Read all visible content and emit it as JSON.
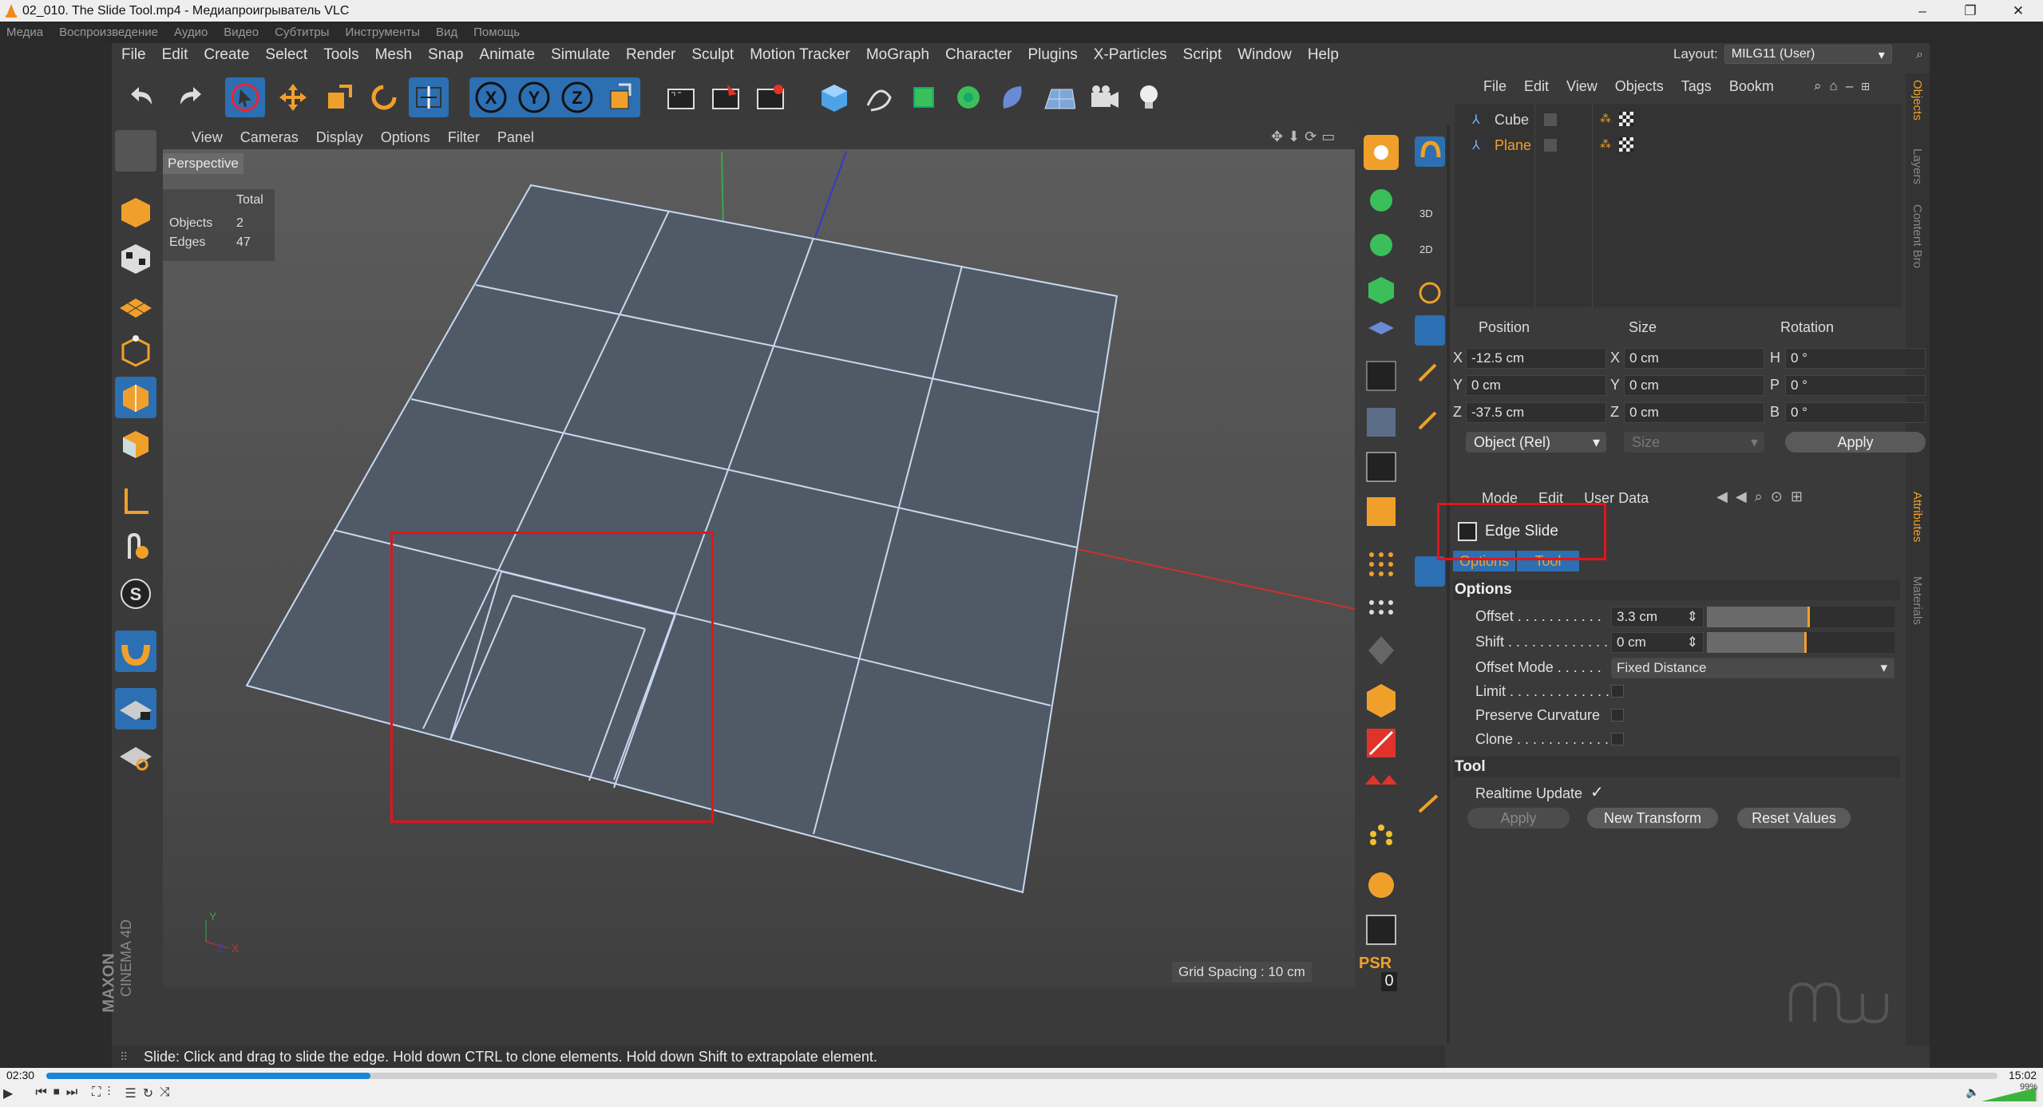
{
  "window": {
    "title": "02_010. The Slide Tool.mp4 - Медиапроигрыватель VLC"
  },
  "vlc_menu": [
    "Медиа",
    "Воспроизведение",
    "Аудио",
    "Видео",
    "Субтитры",
    "Инструменты",
    "Вид",
    "Помощь"
  ],
  "c4d_menu": [
    "File",
    "Edit",
    "Create",
    "Select",
    "Tools",
    "Mesh",
    "Snap",
    "Animate",
    "Simulate",
    "Render",
    "Sculpt",
    "Motion Tracker",
    "MoGraph",
    "Character",
    "Plugins",
    "X-Particles",
    "Script",
    "Window",
    "Help"
  ],
  "layout": {
    "label": "Layout:",
    "value": "MILG11 (User)"
  },
  "viewport": {
    "menu": [
      "View",
      "Cameras",
      "Display",
      "Options",
      "Filter",
      "Panel"
    ],
    "label": "Perspective",
    "hud": {
      "header": "Total",
      "rows": [
        {
          "k": "Objects",
          "v": "2"
        },
        {
          "k": "Edges",
          "v": "47"
        }
      ]
    },
    "grid_spacing": "Grid Spacing : 10 cm",
    "axis_y": "Y",
    "axis_z": "Z",
    "axis_x": "X"
  },
  "objects_panel": {
    "menu": [
      "File",
      "Edit",
      "View",
      "Objects",
      "Tags",
      "Bookm"
    ],
    "items": [
      {
        "name": "Cube",
        "color": "#d9d9d9"
      },
      {
        "name": "Plane",
        "color": "#f0a02a"
      }
    ]
  },
  "side_tabs": {
    "objects": "Objects",
    "layers": "Layers",
    "content": "Content Bro",
    "attributes": "Attributes",
    "materials": "Materials"
  },
  "coords": {
    "headers": [
      "Position",
      "Size",
      "Rotation"
    ],
    "rows": [
      {
        "axis": "X",
        "pos": "-12.5 cm",
        "saxis": "X",
        "size": "0 cm",
        "raxis": "H",
        "rot": "0 °"
      },
      {
        "axis": "Y",
        "pos": "0 cm",
        "saxis": "Y",
        "size": "0 cm",
        "raxis": "P",
        "rot": "0 °"
      },
      {
        "axis": "Z",
        "pos": "-37.5 cm",
        "saxis": "Z",
        "size": "0 cm",
        "raxis": "B",
        "rot": "0 °"
      }
    ],
    "mode": "Object (Rel)",
    "size_mode": "Size",
    "apply": "Apply"
  },
  "attributes": {
    "menu": [
      "Mode",
      "Edit",
      "User Data"
    ],
    "tool_name": "Edge Slide",
    "tabs": [
      "Options",
      "Tool"
    ],
    "options_header": "Options",
    "offset_label": "Offset . . . . . . . . . . .",
    "offset_value": "3.3 cm",
    "offset_slider": 0.55,
    "shift_label": "Shift . . . . . . . . . . . . .",
    "shift_value": "0 cm",
    "shift_slider": 0.53,
    "offset_mode_label": "Offset Mode . . . . . .",
    "offset_mode_value": "Fixed Distance",
    "limit_label": "Limit . . . . . . . . . . . . .",
    "preserve_label": "Preserve Curvature",
    "clone_label": "Clone . . . . . . . . . . . .",
    "tool_header": "Tool",
    "realtime_label": "Realtime Update",
    "realtime_check": "✓",
    "apply": "Apply",
    "new_transform": "New Transform",
    "reset_values": "Reset Values"
  },
  "psr": {
    "label": "PSR",
    "value": "0"
  },
  "brand": {
    "maxon": "MAXON",
    "c4d": "CINEMA 4D"
  },
  "status": "Slide: Click and drag to slide the edge. Hold down CTRL to clone elements. Hold down Shift to extrapolate element.",
  "player": {
    "elapsed": "02:30",
    "total": "15:02",
    "progress": 0.166,
    "volume": "99%"
  },
  "colors": {
    "accent": "#2c6fb2",
    "highlight": "#e0151b",
    "plane_label": "#f0a02a",
    "attr_accent": "#f0a02a"
  }
}
